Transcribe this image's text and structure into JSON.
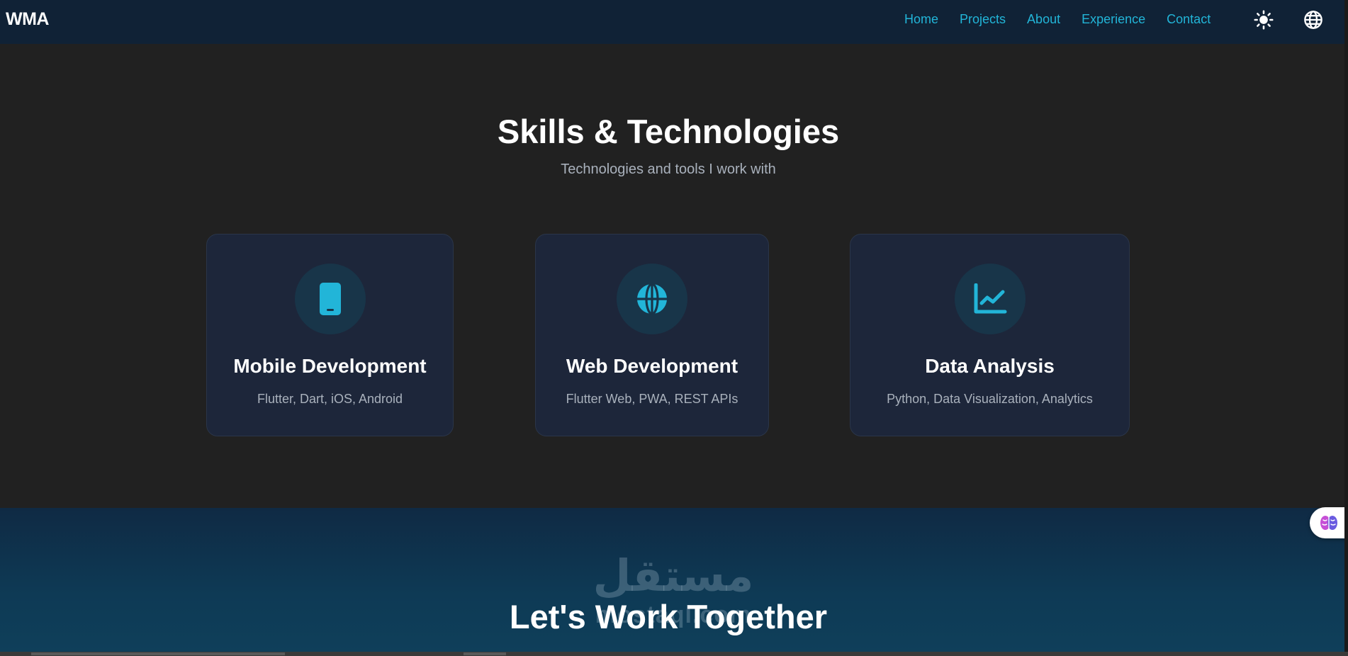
{
  "brand": "WMA",
  "nav": {
    "links": [
      "Home",
      "Projects",
      "About",
      "Experience",
      "Contact"
    ],
    "theme_icon": "sun-icon",
    "language_icon": "globe-icon"
  },
  "skills": {
    "title": "Skills & Technologies",
    "subtitle": "Technologies and tools I work with",
    "cards": [
      {
        "icon": "mobile-icon",
        "title": "Mobile Development",
        "desc": "Flutter, Dart, iOS, Android"
      },
      {
        "icon": "globe-icon",
        "title": "Web Development",
        "desc": "Flutter Web, PWA, REST APIs"
      },
      {
        "icon": "chart-icon",
        "title": "Data Analysis",
        "desc": "Python, Data Visualization, Analytics"
      }
    ]
  },
  "cta": {
    "title": "Let's Work Together",
    "watermark_ar": "مستقل",
    "watermark_en": "mostaql.com"
  },
  "fab_icon": "brain-icon",
  "colors": {
    "accent": "#22b5d8",
    "nav_bg": "#102236",
    "page_bg": "#212121",
    "card_bg": "#1d263a",
    "icon_circle_bg": "#183549"
  }
}
